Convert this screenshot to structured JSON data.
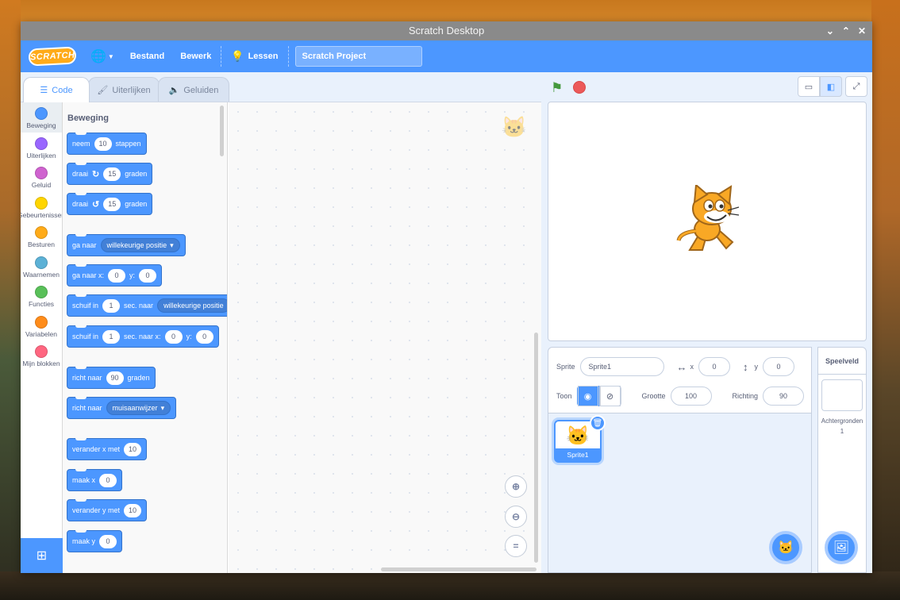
{
  "window": {
    "title": "Scratch Desktop",
    "controls": [
      "⌄",
      "⌃",
      "✕"
    ]
  },
  "menubar": {
    "logo": "SCRATCH",
    "file": "Bestand",
    "edit": "Bewerk",
    "tutorials": "Lessen",
    "project_title": "Scratch Project"
  },
  "tabs": {
    "code": "Code",
    "costumes": "Uiterlijken",
    "sounds": "Geluiden"
  },
  "categories": [
    {
      "label": "Beweging",
      "color": "#4c97ff"
    },
    {
      "label": "Uiterlijken",
      "color": "#9966ff"
    },
    {
      "label": "Geluid",
      "color": "#cf63cf"
    },
    {
      "label": "Gebeurtenissen",
      "color": "#ffd500"
    },
    {
      "label": "Besturen",
      "color": "#ffab19"
    },
    {
      "label": "Waarnemen",
      "color": "#5cb1d6"
    },
    {
      "label": "Functies",
      "color": "#59c059"
    },
    {
      "label": "Variabelen",
      "color": "#ff8c1a"
    },
    {
      "label": "Mijn blokken",
      "color": "#ff6680"
    }
  ],
  "palette": {
    "heading": "Beweging",
    "move": {
      "a": "neem",
      "v": "10",
      "b": "stappen"
    },
    "turn_right": {
      "a": "draai",
      "v": "15",
      "b": "graden"
    },
    "turn_left": {
      "a": "draai",
      "v": "15",
      "b": "graden"
    },
    "goto": {
      "a": "ga naar",
      "d": "willekeurige positie"
    },
    "goto_xy": {
      "a": "ga naar x:",
      "x": "0",
      "b": "y:",
      "y": "0"
    },
    "glide": {
      "a": "schuif in",
      "v": "1",
      "b": "sec. naar",
      "d": "willekeurige positie"
    },
    "glide_xy": {
      "a": "schuif in",
      "v": "1",
      "b": "sec. naar x:",
      "x": "0",
      "c": "y:",
      "y": "0"
    },
    "point": {
      "a": "richt naar",
      "v": "90",
      "b": "graden"
    },
    "point_towards": {
      "a": "richt naar",
      "d": "muisaanwijzer"
    },
    "change_x": {
      "a": "verander x met",
      "v": "10"
    },
    "set_x": {
      "a": "maak x",
      "v": "0"
    },
    "change_y": {
      "a": "verander y met",
      "v": "10"
    },
    "set_y": {
      "a": "maak y",
      "v": "0"
    }
  },
  "sprite_info": {
    "sprite_label": "Sprite",
    "sprite_name": "Sprite1",
    "x_label": "x",
    "x": "0",
    "y_label": "y",
    "y": "0",
    "show_label": "Toon",
    "size_label": "Grootte",
    "size": "100",
    "direction_label": "Richting",
    "direction": "90"
  },
  "sprites": [
    {
      "name": "Sprite1"
    }
  ],
  "stage_panel": {
    "heading": "Speelveld",
    "backdrops_label": "Achtergronden",
    "backdrops_count": "1"
  }
}
